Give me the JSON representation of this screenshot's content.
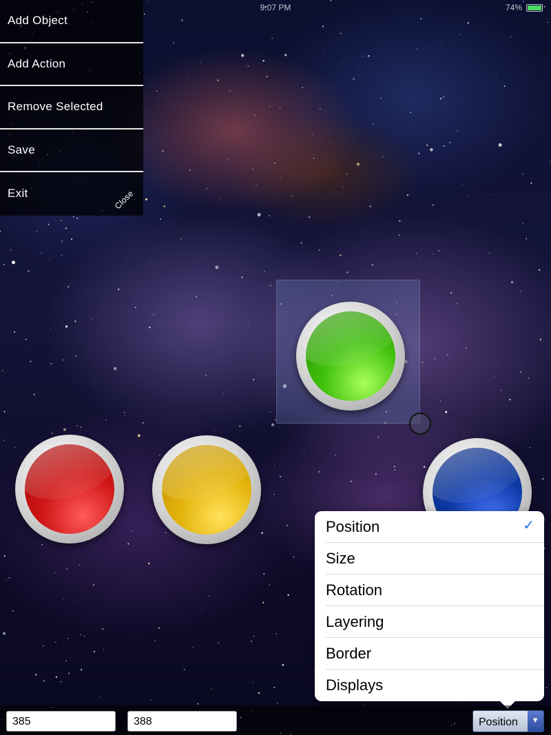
{
  "status_bar": {
    "time": "9:07 PM",
    "battery": "74%"
  },
  "menu": {
    "items": [
      {
        "label": "Add Object"
      },
      {
        "label": "Add Action"
      },
      {
        "label": "Remove Selected"
      },
      {
        "label": "Save"
      },
      {
        "label": "Exit"
      }
    ],
    "close_label": "Close"
  },
  "canvas_buttons": [
    {
      "color": "red",
      "hex": "#cf1515"
    },
    {
      "color": "yellow",
      "hex": "#e2b20a"
    },
    {
      "color": "green",
      "hex": "#3fbf0c",
      "selected": true
    },
    {
      "color": "blue",
      "hex": "#0e3aa8"
    }
  ],
  "property_menu": {
    "options": [
      {
        "label": "Position",
        "checked": true
      },
      {
        "label": "Size"
      },
      {
        "label": "Rotation"
      },
      {
        "label": "Layering"
      },
      {
        "label": "Border"
      },
      {
        "label": "Displays"
      }
    ],
    "check_glyph": "✓",
    "check_color": "#1a73e8"
  },
  "bottom_bar": {
    "x_value": "385",
    "y_value": "388",
    "picker_label": "Position",
    "picker_arrow": "▼"
  }
}
